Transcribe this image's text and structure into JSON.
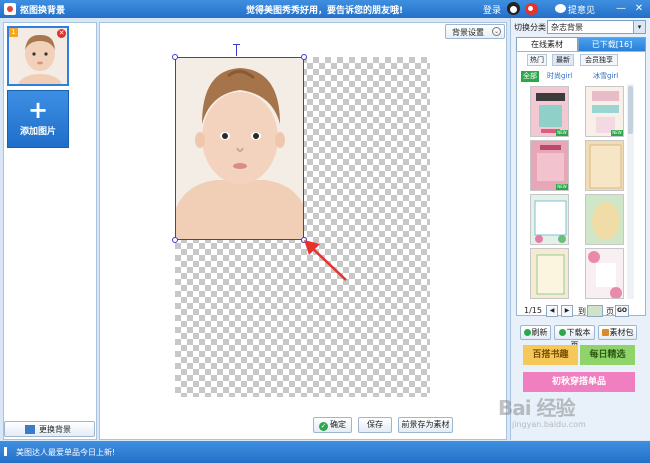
{
  "titlebar": {
    "title": "抠图换背景",
    "promo": "觉得美图秀秀好用，要告诉您的朋友哦!",
    "login": "登录",
    "feedback": "提意见",
    "minimize": "—",
    "close": "✕"
  },
  "left": {
    "badge": "1",
    "remove": "✕",
    "add_plus": "+",
    "add_label": "添加图片",
    "change_bg": "更换背景"
  },
  "canvas": {
    "bg_settings": "背景设置",
    "bg_settings_dd": "⌄"
  },
  "actions": {
    "ok_check": "✓",
    "ok": "确定",
    "save": "保存",
    "save_as": "前景存为素材"
  },
  "right": {
    "category_label": "切换分类",
    "category_value": "杂志背景",
    "category_dd": "▾",
    "tab_online": "在线素材",
    "tab_downloaded": "已下载[16]",
    "subtabs": [
      "热门",
      "最新",
      "会员独享"
    ],
    "filters": [
      "全部",
      "时尚girl",
      "冰雪girl"
    ],
    "new_badge": "NEW",
    "pager": {
      "page_info": "1/15",
      "prev": "◀",
      "next": "▶",
      "to": "到",
      "page": "页",
      "go": "GO"
    },
    "buttons": [
      "刷新",
      "下载本页",
      "素材包"
    ],
    "promos": [
      "百搭书趣",
      "每日精选",
      "初秋穿搭单品"
    ]
  },
  "statusbar": {
    "text": "美图达人最爱单品今日上新!"
  },
  "watermark": {
    "text": "Bai 经验",
    "sub": "jingyan.baidu.com"
  },
  "colors": {
    "accent": "#2a7fd7",
    "selection": "#3b3bd6",
    "arrow": "#e8322c"
  }
}
